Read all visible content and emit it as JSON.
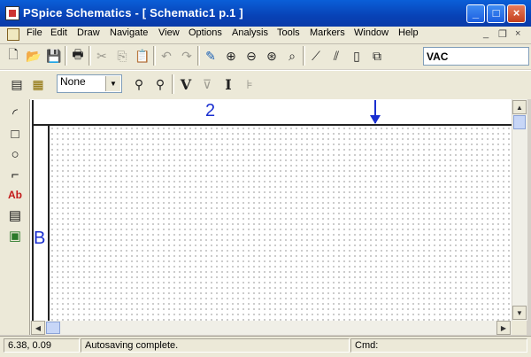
{
  "window": {
    "title": "PSpice Schematics - [ Schematic1  p.1   ]",
    "controls": {
      "minimize": "_",
      "maximize": "□",
      "close": "×"
    }
  },
  "menu": {
    "items": [
      "File",
      "Edit",
      "Draw",
      "Navigate",
      "View",
      "Options",
      "Analysis",
      "Tools",
      "Markers",
      "Window",
      "Help"
    ],
    "mdi": {
      "minimize": "_",
      "restore": "❐",
      "close": "×"
    }
  },
  "toolbar1": {
    "part_field": "VAC"
  },
  "toolbar2": {
    "combo_value": "None",
    "v_label": "V",
    "i_label": "I"
  },
  "canvas": {
    "border_column": "2",
    "border_row": "B"
  },
  "status": {
    "coords": "6.38,  0.09",
    "message": "Autosaving complete.",
    "cmd_label": "Cmd:"
  },
  "colors": {
    "titlebar": "#0842b6",
    "border_label": "#1a2fd0"
  }
}
